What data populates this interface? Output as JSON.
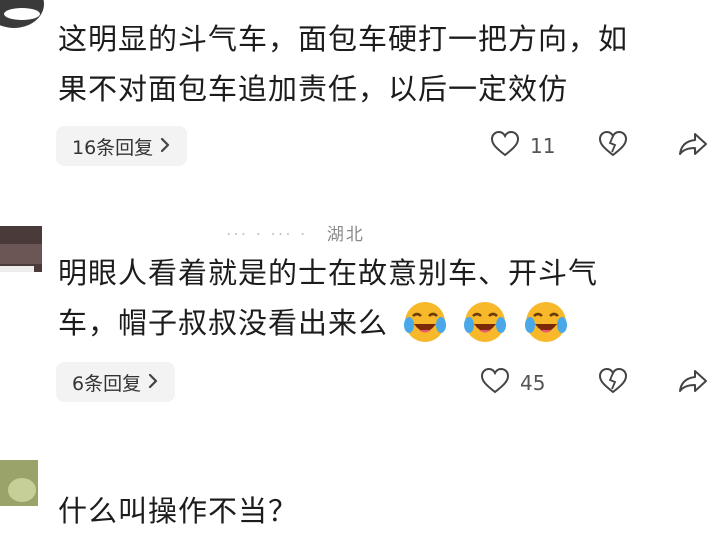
{
  "comments": [
    {
      "lines": [
        "这明显的斗气车，面包车硬打一把方向，如",
        "果不对面包车追加责任，以后一定效仿"
      ],
      "replies_label": "16条回复",
      "likes": "11"
    },
    {
      "meta": "湖北",
      "lines": [
        "明眼人看着就是的士在故意别车、开斗气",
        "车，帽子叔叔没看出来么"
      ],
      "emoji_names": [
        "tears-of-joy-emoji",
        "tears-of-joy-emoji",
        "tears-of-joy-emoji"
      ],
      "replies_label": "6条回复",
      "likes": "45"
    },
    {
      "lines": [
        "什么叫操作不当？"
      ]
    }
  ],
  "icons": {
    "chevron": "chevron-right-icon",
    "like": "heart-icon",
    "dislike": "dislike-heart-icon",
    "share": "share-icon"
  },
  "colors": {
    "background": "#ffffff",
    "text": "#1c1c1c",
    "chip_background": "#f3f3f3",
    "emoji_face": "#f7b829"
  }
}
